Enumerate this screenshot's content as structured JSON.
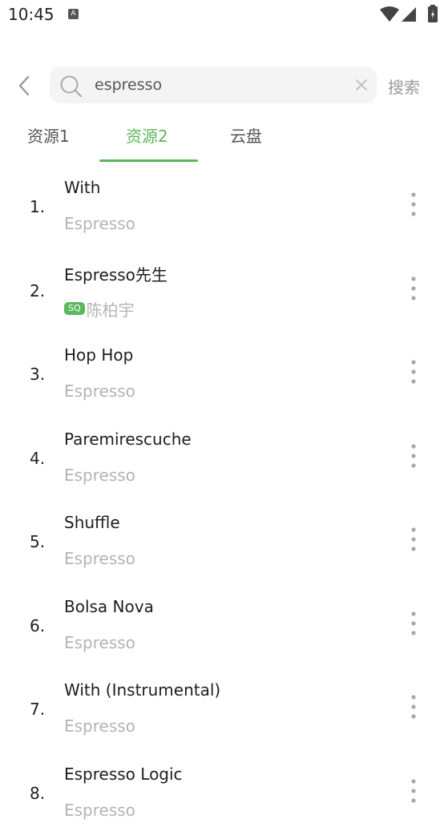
{
  "status": {
    "time": "10:45",
    "notif_letter": "A"
  },
  "search": {
    "value": "espresso",
    "button_label": "搜索"
  },
  "tabs": [
    "资源1",
    "资源2",
    "云盘"
  ],
  "colors": {
    "accent": "#5cb85c",
    "muted": "#b4b4b4"
  },
  "results": [
    {
      "num": "1.",
      "title": "With",
      "sub": "Espresso"
    },
    {
      "num": "2.",
      "title": "Espresso先生",
      "badge": "SQ",
      "sub": "陈柏宇"
    },
    {
      "num": "3.",
      "title": "Hop Hop",
      "sub": "Espresso"
    },
    {
      "num": "4.",
      "title": "Paremirescuche",
      "sub": "Espresso"
    },
    {
      "num": "5.",
      "title": "Shuffle",
      "sub": "Espresso"
    },
    {
      "num": "6.",
      "title": "Bolsa Nova",
      "sub": "Espresso"
    },
    {
      "num": "7.",
      "title": "With (Instrumental)",
      "sub": "Espresso"
    },
    {
      "num": "8.",
      "title": "Espresso Logic",
      "sub": "Espresso"
    }
  ]
}
